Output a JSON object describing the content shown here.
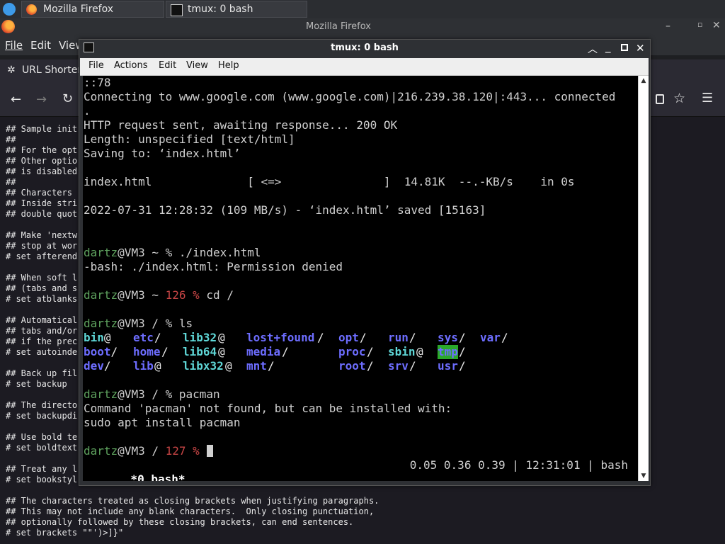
{
  "taskbar": {
    "tabs": [
      {
        "label": "Mozilla Firefox"
      },
      {
        "label": "tmux: 0 bash"
      }
    ]
  },
  "firefox": {
    "title": "Mozilla Firefox",
    "menu": [
      "File",
      "Edit",
      "View"
    ],
    "bookmark": "URL Shorter",
    "content_lines": [
      "## Sample init",
      "##",
      "## For the opt",
      "## Other optio",
      "## is disabled",
      "##",
      "## Characters",
      "## Inside stri",
      "## double quot",
      "",
      "## Make 'nextw",
      "## stop at wor",
      "# set afterend",
      "",
      "## When soft l",
      "## (tabs and s",
      "# set atblanks",
      "",
      "## Automatical",
      "## tabs and/or",
      "## if the prec",
      "# set autoinde",
      "",
      "## Back up fil",
      "# set backup",
      "",
      "## The directo",
      "# set backupdi",
      "",
      "## Use bold te",
      "# set boldtext",
      "",
      "## Treat any l",
      "# set bookstyl",
      "",
      "## The characters treated as closing brackets when justifying paragraphs.",
      "## This may not include any blank characters.  Only closing punctuation,",
      "## optionally followed by these closing brackets, can end sentences.",
      "# set brackets \"\"')>]}\""
    ]
  },
  "terminal": {
    "title": "tmux: 0 bash",
    "menu": [
      "File",
      "Actions",
      "Edit",
      "View",
      "Help"
    ],
    "lines": {
      "l1": "::78",
      "l2": "Connecting to www.google.com (www.google.com)|216.239.38.120|:443... connected",
      "l3": ".",
      "l4": "HTTP request sent, awaiting response... 200 OK",
      "l5": "Length: unspecified [text/html]",
      "l6": "Saving to: ‘index.html’",
      "l8": "index.html              [ <=>               ]  14.81K  --.-KB/s    in 0s",
      "l10": "2022-07-31 12:28:32 (109 MB/s) - ‘index.html’ saved [15163]",
      "p1_user": "dartz",
      "p1_host": "@VM3 ~ % ./index.html",
      "l13": "-bash: ./index.html: Permission denied",
      "p2_user": "dartz",
      "p2_host": "@VM3 ~ ",
      "p2_code": "126 %",
      "p2_cmd": " cd /",
      "p3_user": "dartz",
      "p3_host": "@VM3 / % ls",
      "p4_user": "dartz",
      "p4_host": "@VM3 / % pacman",
      "l24": "Command 'pacman' not found, but can be installed with:",
      "l25": "sudo apt install pacman",
      "p5_user": "dartz",
      "p5_host": "@VM3 / ",
      "p5_code": "127 %",
      "status_left": " *0 bash*",
      "status_right": "0.05 0.36 0.39 | 12:31:01 | bash"
    },
    "ls": [
      [
        "bin",
        "@",
        "etc",
        "/",
        "lib32",
        "@",
        "lost+found",
        "/",
        "opt",
        "/",
        "run",
        "/",
        "sys",
        "/",
        "var",
        "/"
      ],
      [
        "boot",
        "/",
        "home",
        "/",
        "lib64",
        "@",
        "media",
        "/",
        "proc",
        "/",
        "sbin",
        "@",
        "tmp",
        "/"
      ],
      [
        "dev",
        "/",
        "lib",
        "@",
        "libx32",
        "@",
        "mnt",
        "/",
        "root",
        "/",
        "srv",
        "/",
        "usr",
        "/"
      ]
    ]
  }
}
